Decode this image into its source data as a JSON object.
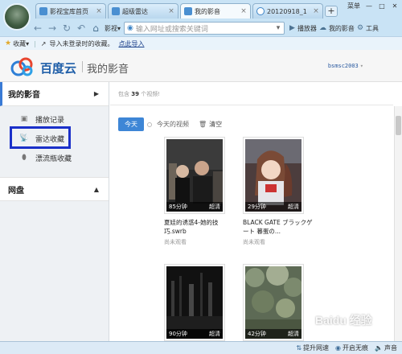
{
  "browser": {
    "tabs": [
      {
        "label": "影视宝库首页",
        "icon": "film-icon"
      },
      {
        "label": "超级雷达",
        "icon": "radar-icon"
      },
      {
        "label": "我的影音",
        "icon": "video-icon",
        "active": true
      },
      {
        "label": "20120918_1",
        "icon": "clock-icon"
      }
    ],
    "new_tab": "+",
    "window": {
      "menu": "菜单",
      "minimize": "—",
      "maximize": "□",
      "close": "✕"
    },
    "nav": {
      "video_menu": "影视",
      "address_placeholder": "输入网址或搜索关键词",
      "player": "播放器",
      "my_video": "我的影音",
      "more": "工具"
    },
    "favbar": {
      "favorites": "收藏",
      "note": "导入未登录时的收藏。",
      "link": "点此导入"
    }
  },
  "app": {
    "brand": "百度云",
    "subtitle": "我的影音",
    "user": "bsmsc2003"
  },
  "sidebar": {
    "section_my_video": "我的影音",
    "items": [
      {
        "label": "播放记录",
        "icon": "play-record-icon"
      },
      {
        "label": "雷达收藏",
        "icon": "radar-icon"
      },
      {
        "label": "漂流瓶收藏",
        "icon": "bottle-icon"
      }
    ],
    "section_netdisk": "网盘"
  },
  "main": {
    "info_prefix": "包含",
    "info_count": "39",
    "info_suffix": "个视频!",
    "filter_today": "今天",
    "filter_today_videos": "今天的视频",
    "clear": "清空",
    "videos": [
      {
        "duration": "85分钟",
        "quality": "超清",
        "title": "夏娃的诱惑4-她的技巧.swrb",
        "status": "尚未观看"
      },
      {
        "duration": "29分钟",
        "quality": "超清",
        "title": "BLACK GATE ブラックゲート 暮蛋の...",
        "status": "尚未观看"
      },
      {
        "duration": "90分钟",
        "quality": "超清",
        "title": "",
        "status": ""
      },
      {
        "duration": "42分钟",
        "quality": "超清",
        "title": "",
        "status": ""
      }
    ]
  },
  "statusbar": {
    "speed": "提升网速",
    "wifi": "开启无痕",
    "sound": "声音"
  },
  "watermark": "Baidu 经验"
}
